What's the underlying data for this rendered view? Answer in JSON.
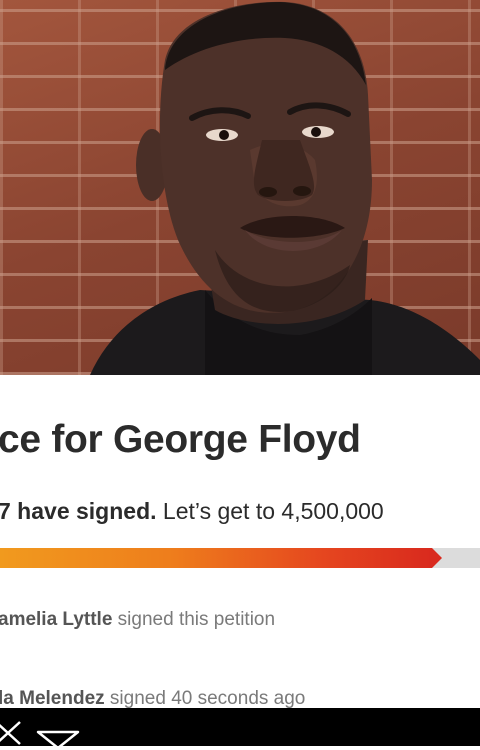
{
  "petition": {
    "title": "ce for George Floyd",
    "signed_count": "7 have signed.",
    "goal_text": " Let’s get to 4,500,000",
    "progress_fraction": 0.92,
    "recent_signers": [
      {
        "name": "amelia Lyttle",
        "action": " signed this petition"
      },
      {
        "name": "la Melendez",
        "action": " signed 40 seconds ago"
      }
    ]
  },
  "bottom_bar": {
    "icons": [
      "close-icon",
      "chevron-down-icon"
    ]
  },
  "colors": {
    "progress_start": "#f19a1e",
    "progress_end": "#d92a1e",
    "track": "#dcdcdc",
    "title": "#2b2b2b",
    "muted": "#7a7a7a"
  }
}
